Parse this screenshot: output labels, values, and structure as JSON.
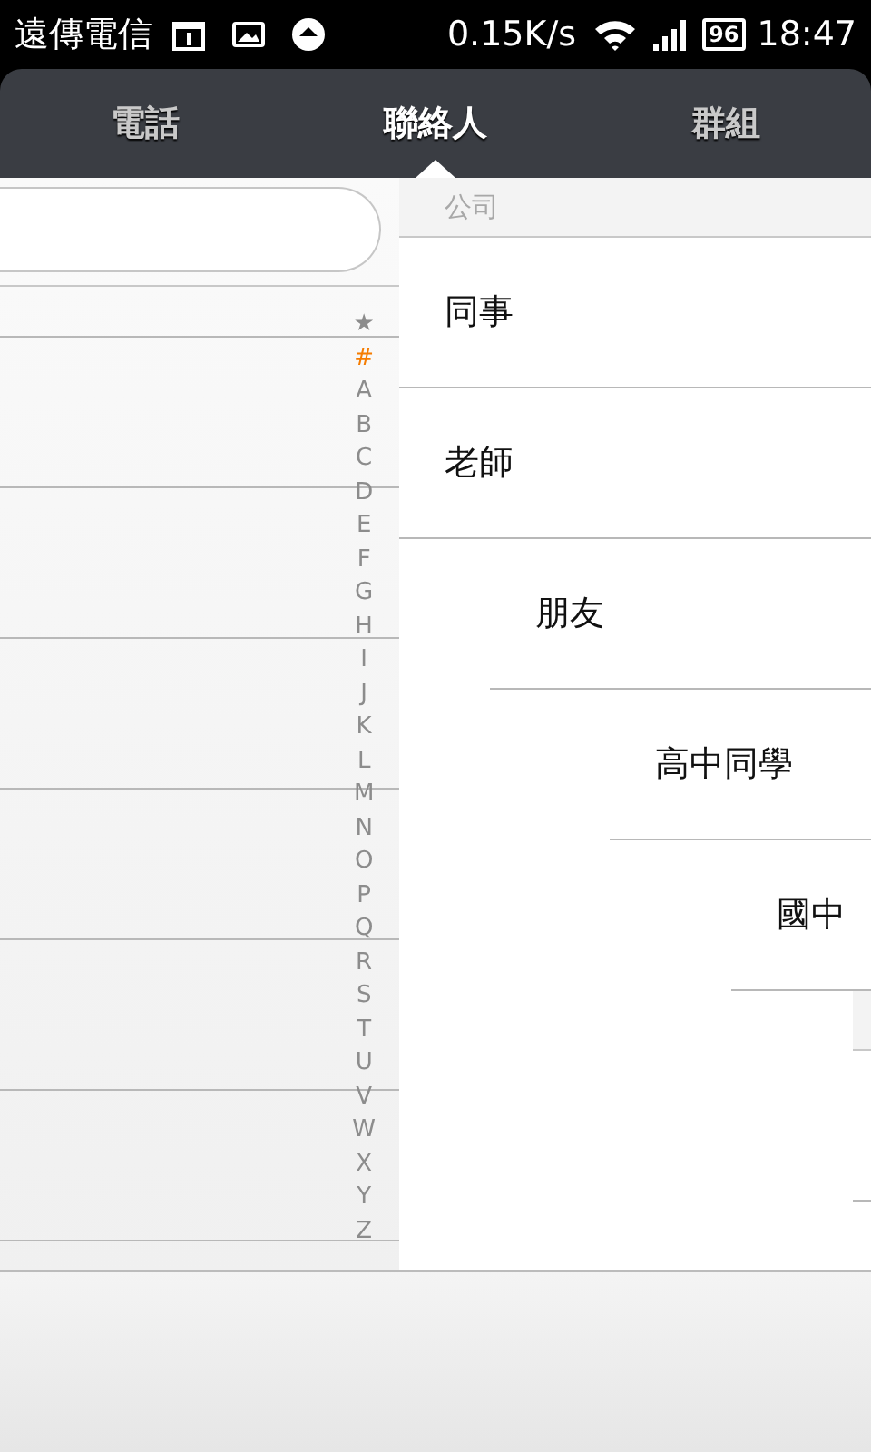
{
  "status_bar": {
    "carrier": "遠傳電信",
    "speed": "0.15K/s",
    "battery": "96",
    "time": "18:47"
  },
  "tabs": [
    {
      "label": "電話",
      "selected": false
    },
    {
      "label": "聯絡人",
      "selected": true
    },
    {
      "label": "群組",
      "selected": false
    }
  ],
  "index_bar": [
    {
      "label": "★",
      "selected": false
    },
    {
      "label": "#",
      "selected": true
    },
    {
      "label": "A",
      "selected": false
    },
    {
      "label": "B",
      "selected": false
    },
    {
      "label": "C",
      "selected": false
    },
    {
      "label": "D",
      "selected": false
    },
    {
      "label": "E",
      "selected": false
    },
    {
      "label": "F",
      "selected": false
    },
    {
      "label": "G",
      "selected": false
    },
    {
      "label": "H",
      "selected": false
    },
    {
      "label": "I",
      "selected": false
    },
    {
      "label": "J",
      "selected": false
    },
    {
      "label": "K",
      "selected": false
    },
    {
      "label": "L",
      "selected": false
    },
    {
      "label": "M",
      "selected": false
    },
    {
      "label": "N",
      "selected": false
    },
    {
      "label": "O",
      "selected": false
    },
    {
      "label": "P",
      "selected": false
    },
    {
      "label": "Q",
      "selected": false
    },
    {
      "label": "R",
      "selected": false
    },
    {
      "label": "S",
      "selected": false
    },
    {
      "label": "T",
      "selected": false
    },
    {
      "label": "U",
      "selected": false
    },
    {
      "label": "V",
      "selected": false
    },
    {
      "label": "W",
      "selected": false
    },
    {
      "label": "X",
      "selected": false
    },
    {
      "label": "Y",
      "selected": false
    },
    {
      "label": "Z",
      "selected": false
    }
  ],
  "groups": {
    "section": "公司",
    "items": [
      {
        "name": "同事"
      },
      {
        "name": "老師"
      },
      {
        "name": "朋友"
      },
      {
        "name": "高中同學"
      },
      {
        "name": "國中"
      }
    ]
  }
}
